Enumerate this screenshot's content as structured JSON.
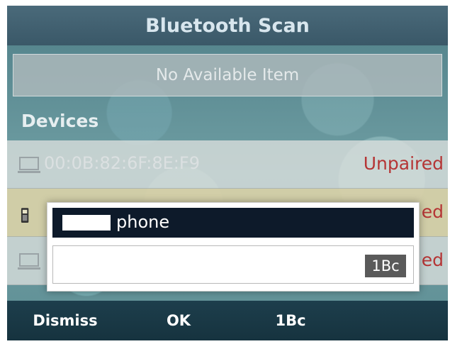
{
  "title": "Bluetooth Scan",
  "available": {
    "empty_text": "No Available Item"
  },
  "devices": {
    "header": "Devices",
    "items": [
      {
        "name": "00:0B:82:6F:8E:F9",
        "status": "Unpaired",
        "icon": "computer-icon"
      },
      {
        "name": "",
        "status": "ed",
        "icon": "mobile-phone-icon"
      },
      {
        "name": "",
        "status": "ed",
        "icon": "computer-icon"
      }
    ]
  },
  "dialog": {
    "title": "phone",
    "input_value": "",
    "input_mode": "1Bc"
  },
  "softkeys": {
    "dismiss": "Dismiss",
    "ok": "OK",
    "mode": "1Bc"
  },
  "colors": {
    "title_bar": "#3f6070",
    "status_red": "#b53535",
    "dialog_header": "#0d1a2a",
    "softkey_bar": "#1a3a48"
  }
}
